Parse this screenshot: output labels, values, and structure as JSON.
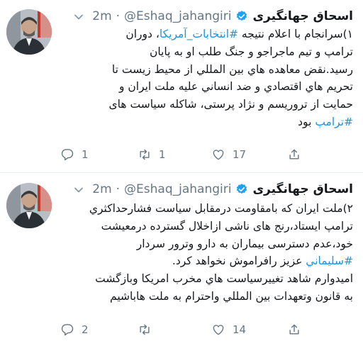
{
  "colors": {
    "link": "#1b95e0",
    "verified": "#1da1f2",
    "muted": "#657786",
    "text": "#14171a"
  },
  "tweets": [
    {
      "author": "اسحاق جهانگیری",
      "handle": "@Eshaq_jahangiri",
      "separator": "·",
      "time": "2m",
      "lines": [
        [
          {
            "t": "۱)سرانجام با اعلام نتیجه "
          },
          {
            "t": "#انتخابات_آمریکا",
            "tag": true
          },
          {
            "t": "، دوران"
          }
        ],
        [
          {
            "t": "ترامپ و تیم ماجراجو و جنگ طلب او به پایان"
          }
        ],
        [
          {
            "t": "رسید.نقض معاهده هاي بين المللي از محيط زيست تا"
          }
        ],
        [
          {
            "t": "تحريم هاي اقتصادي و ضد انساني عليه ملت ايران و"
          }
        ],
        [
          {
            "t": "حمايت از تروريسم و نژاد پرستی، شاكله سياست های"
          }
        ],
        [
          {
            "t": "#ترامپ",
            "tag": true
          },
          {
            "t": " بود"
          }
        ]
      ],
      "actions": {
        "reply_count": "1",
        "retweet_count": "1",
        "like_count": "17"
      }
    },
    {
      "author": "اسحاق جهانگیری",
      "handle": "@Eshaq_jahangiri",
      "separator": "·",
      "time": "2m",
      "lines": [
        [
          {
            "t": "۲)ملت ايران كه بامقاومت درمقابل سياست فشارحداكثري"
          }
        ],
        [
          {
            "t": "ترامپ ايستاد،رنج های ناشی ازاخلال گسترده درمعيشت"
          }
        ],
        [
          {
            "t": "خود،عدم دسترسی بيماران به دارو وترور سردار"
          }
        ],
        [
          {
            "t": "#سليماني",
            "tag": true
          },
          {
            "t": " عزيز رافراموش نخواهد كرد."
          }
        ],
        [
          {
            "t": "اميدوارم شاهد تغييرسياست هاي مخرب امريكا وبازگشت"
          }
        ],
        [
          {
            "t": "به قانون وتعهدات بين المللي واحترام به ملت هاباشيم"
          }
        ]
      ],
      "actions": {
        "reply_count": "2",
        "retweet_count": "",
        "like_count": "14"
      }
    }
  ]
}
